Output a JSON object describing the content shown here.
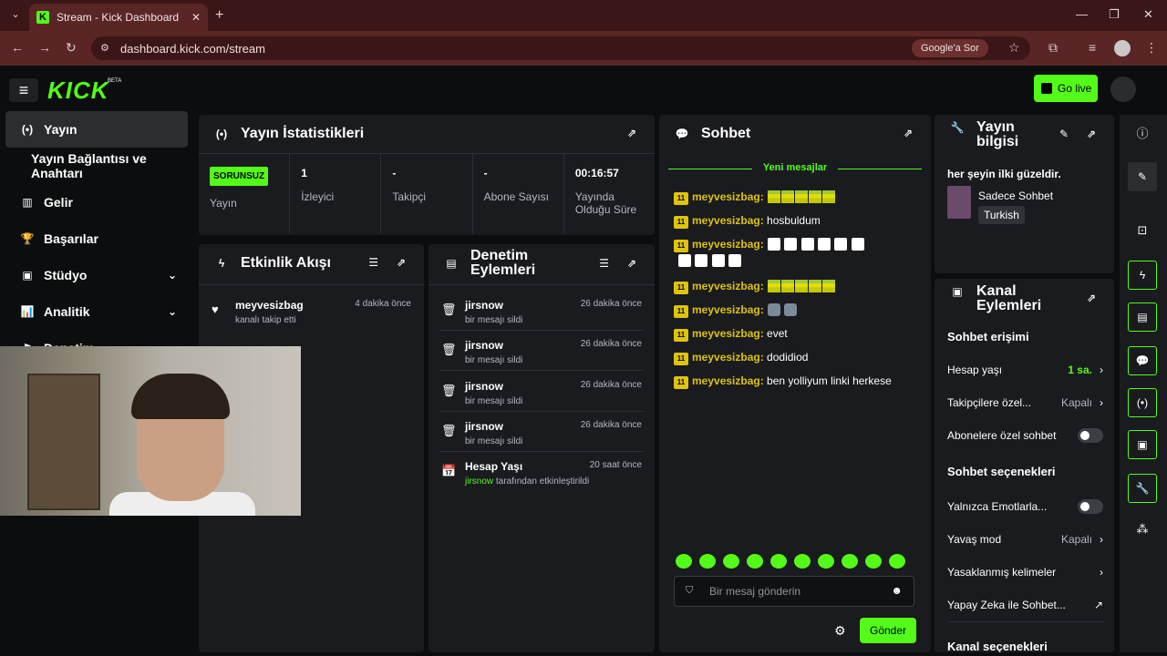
{
  "browser": {
    "tab_title": "Stream - Kick Dashboard",
    "url": "dashboard.kick.com/stream",
    "google_button": "Google'a Sor",
    "tab_close": "✕",
    "new_tab": "+",
    "minimize": "—",
    "maximize": "❐",
    "close": "✕"
  },
  "header": {
    "logo": "KICK",
    "logo_badge": "BETA",
    "go_live": "Go live"
  },
  "sidebar": {
    "items": [
      {
        "label": "Yayın",
        "icon": "broadcast-icon",
        "glyph": "(•)"
      },
      {
        "label": "Yayın Bağlantısı ve Anahtarı"
      },
      {
        "label": "Gelir",
        "icon": "revenue-icon",
        "glyph": "▥"
      },
      {
        "label": "Başarılar",
        "icon": "trophy-icon",
        "glyph": "🏆"
      },
      {
        "label": "Stüdyo",
        "icon": "studio-icon",
        "glyph": "▣",
        "chevron": "⌄"
      },
      {
        "label": "Analitik",
        "icon": "analytics-icon",
        "glyph": "📊",
        "chevron": "⌄"
      },
      {
        "label": "Denetim",
        "icon": "moderation-icon",
        "glyph": "⚑"
      }
    ]
  },
  "stats": {
    "title": "Yayın İstatistikleri",
    "items": [
      {
        "value": "SORUNSUZ",
        "label": "Yayın"
      },
      {
        "value": "1",
        "label": "İzleyici"
      },
      {
        "value": "-",
        "label": "Takipçi"
      },
      {
        "value": "-",
        "label": "Abone Sayısı"
      },
      {
        "value": "00:16:57",
        "label": "Yayında Olduğu Süre"
      }
    ]
  },
  "activity": {
    "title": "Etkinlik Akışı",
    "events": [
      {
        "name": "meyvesizbag",
        "desc": "kanalı takip etti",
        "time": "4 dakika önce"
      }
    ]
  },
  "audit": {
    "title": "Denetim Eylemleri",
    "events": [
      {
        "name": "jirsnow",
        "desc": "bir mesajı sildi",
        "time": "26 dakika önce"
      },
      {
        "name": "jirsnow",
        "desc": "bir mesajı sildi",
        "time": "26 dakika önce"
      },
      {
        "name": "jirsnow",
        "desc": "bir mesajı sildi",
        "time": "26 dakika önce"
      },
      {
        "name": "jirsnow",
        "desc": "bir mesajı sildi",
        "time": "26 dakika önce"
      },
      {
        "name": "Hesap Yaşı",
        "desc_user": "jirsnow",
        "desc": "tarafından etkinleştirildi",
        "time": "20 saat önce"
      }
    ]
  },
  "chat": {
    "title": "Sohbet",
    "new_messages": "Yeni mesajlar",
    "badge": "11",
    "username": "meyvesizbag:",
    "messages": [
      {
        "text": ""
      },
      {
        "text": "hosbuldum"
      },
      {
        "text": ""
      },
      {
        "text": ""
      },
      {
        "text": ""
      },
      {
        "text": "evet"
      },
      {
        "text": "dodidiod"
      },
      {
        "text": "ben yolliyum linki herkese"
      }
    ],
    "input_placeholder": "Bir mesaj gönderin",
    "send": "Gönder"
  },
  "stream_info": {
    "title_line1": "Yayın",
    "title_line2": "bilgisi",
    "stream_title": "her şeyin ilki güzeldir.",
    "category": "Sadece Sohbet",
    "language": "Turkish"
  },
  "channel_actions": {
    "title_line1": "Kanal",
    "title_line2": "Eylemleri",
    "chat_access": "Sohbet erişimi",
    "account_age": "Hesap yaşı",
    "account_age_value": "1 sa.",
    "followers_only": "Takipçilere özel...",
    "followers_only_value": "Kapalı",
    "subs_only": "Abonelere özel sohbet",
    "chat_options": "Sohbet seçenekleri",
    "emotes_only": "Yalnızca Emotlarla...",
    "slow_mode": "Yavaş mod",
    "slow_mode_value": "Kapalı",
    "banned_words": "Yasaklanmış kelimeler",
    "ai_chat": "Yapay Zeka ile Sohbet...",
    "channel_options": "Kanal seçenekleri"
  },
  "colors": {
    "accent": "#53fc18",
    "panel": "#191b1f",
    "background": "#0b0e0f",
    "browser": "#5a2525"
  }
}
